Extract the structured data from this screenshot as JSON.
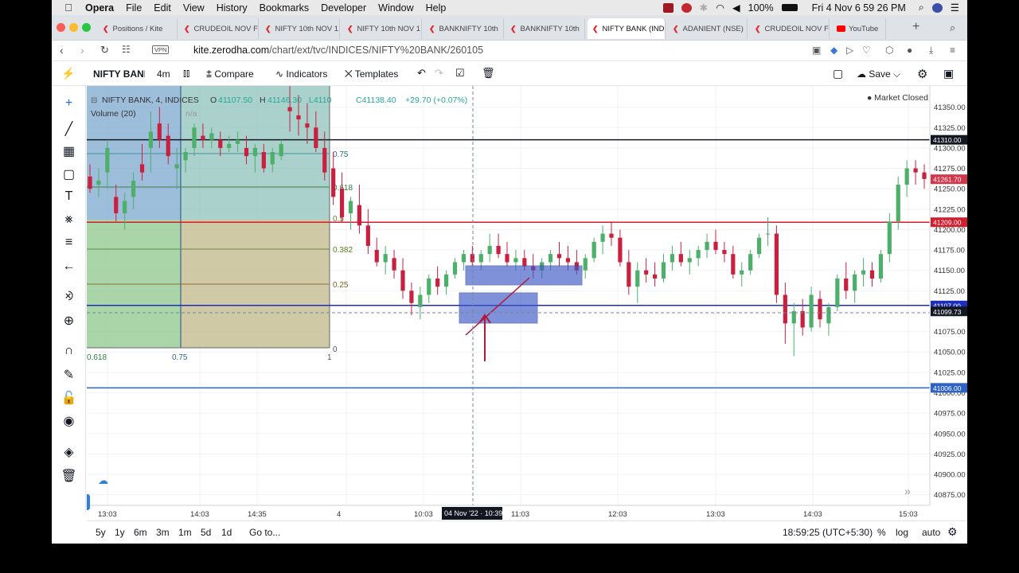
{
  "menubar": {
    "app": "Opera",
    "items": [
      "File",
      "Edit",
      "View",
      "History",
      "Bookmarks",
      "Developer",
      "Window",
      "Help"
    ],
    "battery": "100%",
    "datetime": "Fri 4 Nov  6 59 26 PM"
  },
  "tabs": [
    {
      "label": "Positions / Kite",
      "icon": "kite-icon",
      "active": false
    },
    {
      "label": "CRUDEOIL NOV F",
      "icon": "kite-icon",
      "active": false
    },
    {
      "label": "NIFTY 10th NOV 1",
      "icon": "kite-icon",
      "active": false
    },
    {
      "label": "NIFTY 10th NOV 1",
      "icon": "kite-icon",
      "active": false
    },
    {
      "label": "BANKNIFTY 10th",
      "icon": "kite-icon",
      "active": false
    },
    {
      "label": "BANKNIFTY 10th",
      "icon": "kite-icon",
      "active": false
    },
    {
      "label": "NIFTY BANK (IND",
      "icon": "kite-icon",
      "active": true
    },
    {
      "label": "ADANIENT (NSE)",
      "icon": "kite-icon",
      "active": false
    },
    {
      "label": "CRUDEOIL NOV F",
      "icon": "kite-icon",
      "active": false
    },
    {
      "label": "YouTube",
      "icon": "youtube-icon",
      "active": false
    }
  ],
  "address": {
    "vpn": "VPN",
    "domain": "kite.zerodha.com",
    "path": "/chart/ext/tvc/INDICES/NIFTY%20BANK/260105"
  },
  "toolbar": {
    "symbol": "NIFTY BANK",
    "interval": "4m",
    "compare": "Compare",
    "indicators": "Indicators",
    "templates": "Templates",
    "save": "Save"
  },
  "legend": {
    "title": "NIFTY BANK, 4, INDICES",
    "o_label": "O",
    "o": "41107.50",
    "h_label": "H",
    "h": "41146.30",
    "l": "L4110",
    "c": "C41138.40",
    "change": "+29.70 (+0.07%)",
    "volume": "Volume (20)",
    "volume_value": "n/a",
    "market_status": "Market Closed"
  },
  "fib": {
    "levels": [
      "0.75",
      "0.618",
      "0.5",
      "0.382",
      "0.25",
      "0"
    ],
    "bottom_labels": [
      "0.618",
      "0.75",
      "1"
    ]
  },
  "bottombar": {
    "ranges": [
      "5y",
      "1y",
      "6m",
      "3m",
      "1m",
      "5d",
      "1d"
    ],
    "goto": "Go to...",
    "clock": "18:59:25 (UTC+5:30)",
    "percent": "%",
    "log": "log",
    "auto": "auto"
  },
  "chart_data": {
    "type": "candlestick",
    "title": "NIFTY BANK, 4, INDICES",
    "ylim": [
      40862,
      41376
    ],
    "y_ticks": [
      41350,
      41325,
      41300,
      41275,
      41250,
      41225,
      41200,
      41175,
      41150,
      41125,
      41100,
      41075,
      41050,
      41025,
      41000,
      40975,
      40950,
      40925,
      40900,
      40875
    ],
    "y_tick_labels": [
      "41350.00",
      "41325.00",
      "41300.00",
      "41275.00",
      "41250.00",
      "41225.00",
      "41200.00",
      "41175.00",
      "41150.00",
      "41125.00",
      "41100.00",
      "41075.00",
      "41050.00",
      "41025.00",
      "41000.00",
      "40975.00",
      "40950.00",
      "40925.00",
      "40900.00",
      "40875.00"
    ],
    "x_tick_labels": [
      "13:03",
      "14:03",
      "14:35",
      "4",
      "10:03",
      "11:03",
      "12:03",
      "13:03",
      "14:03",
      "15:03"
    ],
    "crosshair_time": "04 Nov '22 · 10:39",
    "crosshair_price": "41099.73",
    "horizontal_lines": [
      {
        "price": 41310.0,
        "label": "41310.00",
        "color": "#131722"
      },
      {
        "price": 41209.0,
        "label": "41209.00",
        "color": "#d11e2f"
      },
      {
        "price": 41107.0,
        "label": "41107.00",
        "color": "#1e2eb8"
      },
      {
        "price": 41006.0,
        "label": "41006.00",
        "color": "#2d63c8"
      }
    ],
    "last_price": {
      "price": 41261.7,
      "label": "41261.70",
      "color": "#d3354a"
    },
    "candles": [
      [
        41265,
        41280,
        41245,
        41250
      ],
      [
        41255,
        41275,
        41240,
        41260
      ],
      [
        41270,
        41310,
        41250,
        41300
      ],
      [
        41240,
        41255,
        41210,
        41220
      ],
      [
        41220,
        41245,
        41200,
        41235
      ],
      [
        41240,
        41270,
        41225,
        41260
      ],
      [
        41280,
        41305,
        41260,
        41270
      ],
      [
        41300,
        41345,
        41270,
        41320
      ],
      [
        41330,
        41350,
        41300,
        41310
      ],
      [
        41315,
        41330,
        41280,
        41290
      ],
      [
        41275,
        41300,
        41250,
        41280
      ],
      [
        41285,
        41300,
        41270,
        41295
      ],
      [
        41300,
        41330,
        41290,
        41325
      ],
      [
        41315,
        41330,
        41300,
        41310
      ],
      [
        41310,
        41325,
        41300,
        41318
      ],
      [
        41310,
        41320,
        41290,
        41300
      ],
      [
        41300,
        41315,
        41295,
        41305
      ],
      [
        41305,
        41320,
        41295,
        41310
      ],
      [
        41300,
        41315,
        41280,
        41290
      ],
      [
        41290,
        41305,
        41270,
        41300
      ],
      [
        41295,
        41305,
        41270,
        41275
      ],
      [
        41280,
        41300,
        41270,
        41295
      ],
      [
        41290,
        41310,
        41285,
        41305
      ],
      [
        41350,
        41380,
        41320,
        41345
      ],
      [
        41340,
        41365,
        41315,
        41335
      ],
      [
        41330,
        41355,
        41305,
        41325
      ],
      [
        41325,
        41345,
        41295,
        41300
      ],
      [
        41300,
        41320,
        41260,
        41270
      ],
      [
        41275,
        41295,
        41230,
        41240
      ],
      [
        41250,
        41270,
        41210,
        41215
      ],
      [
        41220,
        41240,
        41200,
        41235
      ],
      [
        41230,
        41255,
        41195,
        41205
      ],
      [
        41205,
        41225,
        41170,
        41180
      ],
      [
        41175,
        41190,
        41155,
        41160
      ],
      [
        41160,
        41180,
        41145,
        41170
      ],
      [
        41165,
        41175,
        41140,
        41150
      ],
      [
        41150,
        41165,
        41115,
        41125
      ],
      [
        41125,
        41135,
        41095,
        41110
      ],
      [
        41105,
        41130,
        41090,
        41120
      ],
      [
        41120,
        41145,
        41110,
        41140
      ],
      [
        41140,
        41155,
        41120,
        41130
      ],
      [
        41130,
        41150,
        41120,
        41145
      ],
      [
        41145,
        41165,
        41140,
        41160
      ],
      [
        41160,
        41175,
        41150,
        41170
      ],
      [
        41170,
        41180,
        41155,
        41160
      ],
      [
        41160,
        41175,
        41150,
        41170
      ],
      [
        41170,
        41195,
        41160,
        41180
      ],
      [
        41180,
        41195,
        41165,
        41170
      ],
      [
        41170,
        41185,
        41155,
        41160
      ],
      [
        41160,
        41175,
        41150,
        41165
      ],
      [
        41165,
        41175,
        41150,
        41155
      ],
      [
        41155,
        41170,
        41140,
        41150
      ],
      [
        41150,
        41165,
        41140,
        41160
      ],
      [
        41160,
        41175,
        41150,
        41170
      ],
      [
        41170,
        41185,
        41155,
        41165
      ],
      [
        41165,
        41180,
        41150,
        41160
      ],
      [
        41160,
        41175,
        41145,
        41150
      ],
      [
        41150,
        41170,
        41140,
        41165
      ],
      [
        41165,
        41190,
        41160,
        41185
      ],
      [
        41185,
        41205,
        41170,
        41195
      ],
      [
        41195,
        41210,
        41180,
        41190
      ],
      [
        41190,
        41200,
        41155,
        41160
      ],
      [
        41160,
        41175,
        41120,
        41130
      ],
      [
        41130,
        41160,
        41110,
        41150
      ],
      [
        41150,
        41165,
        41135,
        41145
      ],
      [
        41145,
        41160,
        41130,
        41140
      ],
      [
        41140,
        41170,
        41135,
        41160
      ],
      [
        41160,
        41180,
        41150,
        41170
      ],
      [
        41170,
        41185,
        41155,
        41160
      ],
      [
        41160,
        41175,
        41145,
        41165
      ],
      [
        41165,
        41180,
        41155,
        41175
      ],
      [
        41175,
        41195,
        41165,
        41185
      ],
      [
        41185,
        41200,
        41170,
        41175
      ],
      [
        41175,
        41185,
        41160,
        41170
      ],
      [
        41170,
        41180,
        41140,
        41145
      ],
      [
        41145,
        41160,
        41130,
        41150
      ],
      [
        41150,
        41175,
        41145,
        41170
      ],
      [
        41170,
        41195,
        41165,
        41190
      ],
      [
        41195,
        41215,
        41180,
        41195
      ],
      [
        41195,
        41205,
        41110,
        41120
      ],
      [
        41120,
        41135,
        41060,
        41085
      ],
      [
        41085,
        41110,
        41045,
        41100
      ],
      [
        41100,
        41115,
        41070,
        41080
      ],
      [
        41080,
        41130,
        41075,
        41120
      ],
      [
        41115,
        41125,
        41080,
        41090
      ],
      [
        41085,
        41110,
        41070,
        41105
      ],
      [
        41105,
        41145,
        41100,
        41140
      ],
      [
        41140,
        41160,
        41115,
        41125
      ],
      [
        41125,
        41150,
        41110,
        41145
      ],
      [
        41145,
        41165,
        41130,
        41150
      ],
      [
        41150,
        41160,
        41130,
        41140
      ],
      [
        41140,
        41175,
        41135,
        41170
      ],
      [
        41170,
        41220,
        41160,
        41210
      ],
      [
        41210,
        41265,
        41200,
        41255
      ],
      [
        41255,
        41285,
        41240,
        41275
      ],
      [
        41275,
        41285,
        41255,
        41270
      ],
      [
        41270,
        41280,
        41250,
        41262
      ]
    ]
  }
}
